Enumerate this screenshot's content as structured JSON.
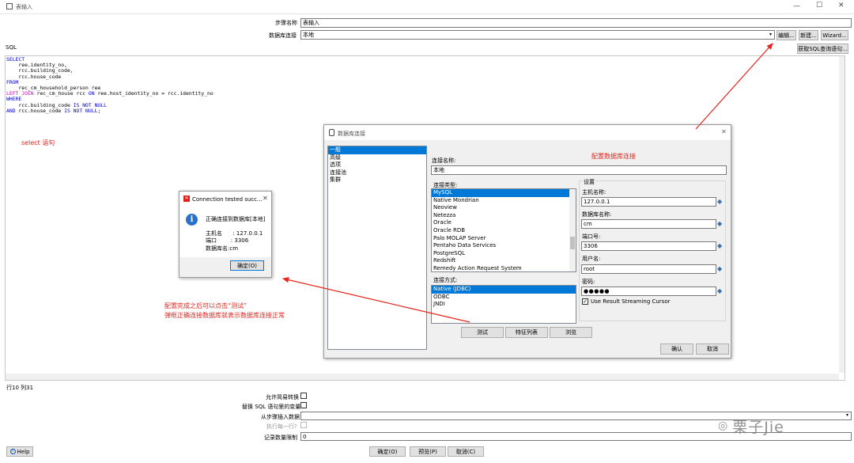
{
  "window": {
    "title": "表输入",
    "min": "—",
    "max": "☐",
    "close": "✕"
  },
  "form": {
    "step_name_label": "步骤名称",
    "step_name_value": "表输入",
    "db_conn_label": "数据库连接",
    "db_conn_value": "本地",
    "edit_btn": "编辑...",
    "new_btn": "新建...",
    "wizard_btn": "Wizard...",
    "get_sql_btn": "获取SQL查询语句...",
    "sql_label": "SQL"
  },
  "sql_lines": [
    {
      "kw": "SELECT",
      "rest": ""
    },
    {
      "kw": "",
      "rest": "    ree.identity_no,"
    },
    {
      "kw": "",
      "rest": "    rcc.building_code,"
    },
    {
      "kw": "",
      "rest": "    rcc.house_code"
    },
    {
      "kw": "FROM",
      "rest": ""
    },
    {
      "kw": "",
      "rest": "    rec_cm_household_person ree"
    },
    {
      "kw": "LEFT JOIN",
      "rest": " rec_cm_house rcc ON ree.host_identity_no = rcc.identity_no"
    },
    {
      "kw": "WHERE",
      "rest": ""
    },
    {
      "kw": "",
      "rest": "    rcc.building_code IS NOT NULL"
    },
    {
      "kw": "AND",
      "rest": " rcc.house_code IS NOT NULL;"
    }
  ],
  "status": {
    "position": "行10 列31"
  },
  "options": {
    "lazy_conv_label": "允许简易转换",
    "replace_vars_label": "替换 SQL 语句里的变量",
    "insert_from_step_label": "从步骤插入数据",
    "exec_each_row_label": "执行每一行?",
    "limit_label": "记录数量限制",
    "limit_value": "0"
  },
  "bottom": {
    "help": "Help",
    "ok": "确定(O)",
    "preview": "预览(P)",
    "cancel": "取消(C)"
  },
  "annotations": {
    "select_note": "select 语句",
    "config_note": "配置数据库连接",
    "test_note_1": "配置完成之后可以点击“测试”",
    "test_note_2": "弹框正确连接数据库就表示数据库连接正常"
  },
  "db_dialog": {
    "title": "数据库连接",
    "nav": [
      "一般",
      "高级",
      "选项",
      "连接池",
      "集群"
    ],
    "conn_name_label": "连接名称:",
    "conn_name_value": "本地",
    "conn_type_label": "连接类型:",
    "conn_types": [
      "MySQL",
      "Native Mondrian",
      "Neoview",
      "Netezza",
      "Oracle",
      "Oracle RDB",
      "Palo MOLAP Server",
      "Pentaho Data Services",
      "PostgreSQL",
      "Redshift",
      "Remedy Action Request System"
    ],
    "access_label": "连接方式:",
    "access_types": [
      "Native (JDBC)",
      "ODBC",
      "JNDI"
    ],
    "settings_label": "设置",
    "host_label": "主机名称:",
    "host_value": "127.0.0.1",
    "dbname_label": "数据库名称:",
    "dbname_value": "cm",
    "port_label": "端口号:",
    "port_value": "3306",
    "user_label": "用户名:",
    "user_value": "root",
    "pass_label": "密码:",
    "pass_value": "●●●●●",
    "streaming_label": "Use Result Streaming Cursor",
    "test_btn": "测试",
    "features_btn": "特征列表",
    "browse_btn": "浏览",
    "ok_btn": "确认",
    "cancel_btn": "取消"
  },
  "popup": {
    "title": "Connection tested succ...",
    "message": "正确连接到数据库[本地]",
    "host_line": "主机名      : 127.0.0.1",
    "port_line": "端口        : 3306",
    "db_line": "数据库名:cm",
    "ok_btn": "确定(O)"
  },
  "watermark": "栗子Jie",
  "colors": {
    "accent": "#0078d7",
    "annotation": "#e8231a",
    "sql_keyword": "#0000c8",
    "sql_join": "#c800c8"
  }
}
